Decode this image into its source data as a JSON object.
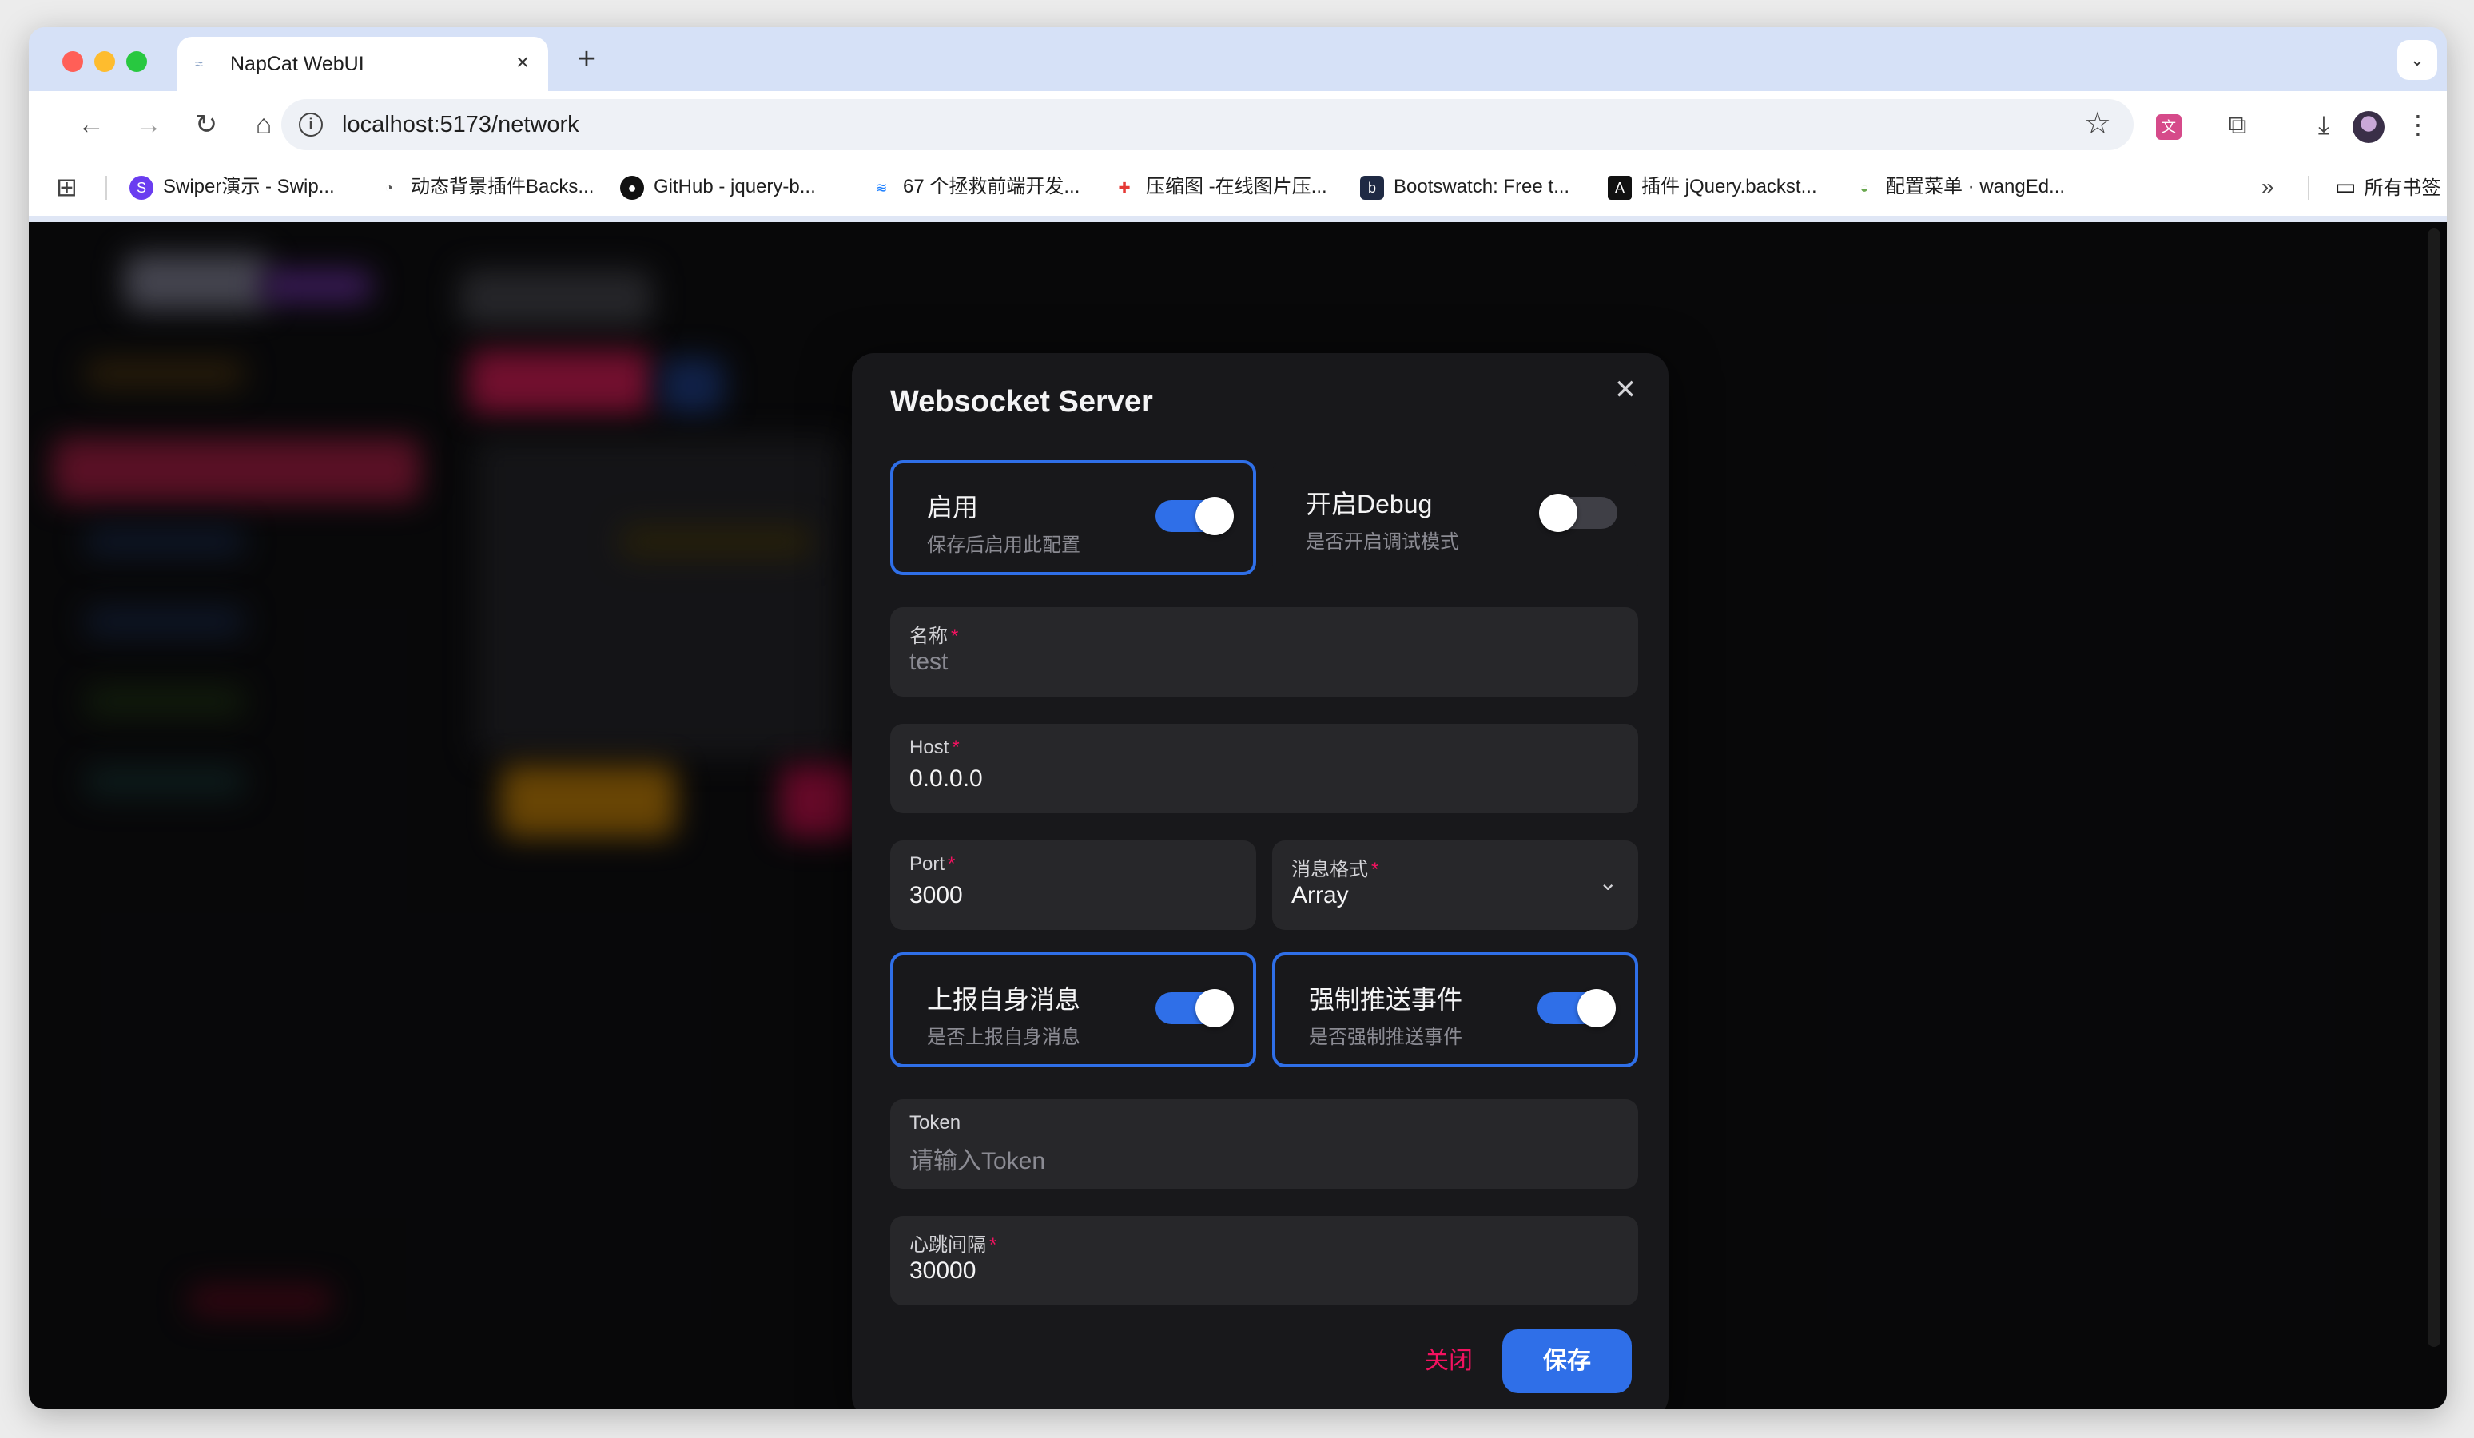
{
  "browser": {
    "tab_title": "NapCat WebUI",
    "url": "localhost:5173/network",
    "bookmarks": [
      {
        "label": "Swiper演示 - Swip...",
        "icon": "swiper-icon",
        "color": "#6a3df0"
      },
      {
        "label": "动态背景插件Backs...",
        "icon": "chrome-icon",
        "color": "#555555"
      },
      {
        "label": "GitHub - jquery-b...",
        "icon": "github-icon",
        "color": "#111111"
      },
      {
        "label": "67 个拯救前端开发...",
        "icon": "juejin-icon",
        "color": "#1e80ff"
      },
      {
        "label": "压缩图 -在线图片压...",
        "icon": "tinyimg-icon",
        "color": "#e53935"
      },
      {
        "label": "Bootswatch: Free t...",
        "icon": "bootswatch-icon",
        "color": "#1f2a44"
      },
      {
        "label": "插件 jQuery.backst...",
        "icon": "a-icon",
        "color": "#111111"
      },
      {
        "label": "配置菜单 · wangEd...",
        "icon": "wangeditor-icon",
        "color": "#6aa84f"
      }
    ],
    "all_bookmarks_label": "所有书签"
  },
  "modal": {
    "title": "Websocket Server",
    "enable": {
      "title": "启用",
      "desc": "保存后启用此配置",
      "on": true
    },
    "debug": {
      "title": "开启Debug",
      "desc": "是否开启调试模式",
      "on": false
    },
    "name": {
      "label": "名称",
      "value": "test"
    },
    "host": {
      "label": "Host",
      "value": "0.0.0.0"
    },
    "port": {
      "label": "Port",
      "value": "3000"
    },
    "message_format": {
      "label": "消息格式",
      "value": "Array"
    },
    "report_self": {
      "title": "上报自身消息",
      "desc": "是否上报自身消息",
      "on": true
    },
    "force_push": {
      "title": "强制推送事件",
      "desc": "是否强制推送事件",
      "on": true
    },
    "token": {
      "label": "Token",
      "placeholder": "请输入Token"
    },
    "heartbeat": {
      "label": "心跳间隔",
      "value": "30000"
    },
    "close_label": "关闭",
    "save_label": "保存"
  }
}
